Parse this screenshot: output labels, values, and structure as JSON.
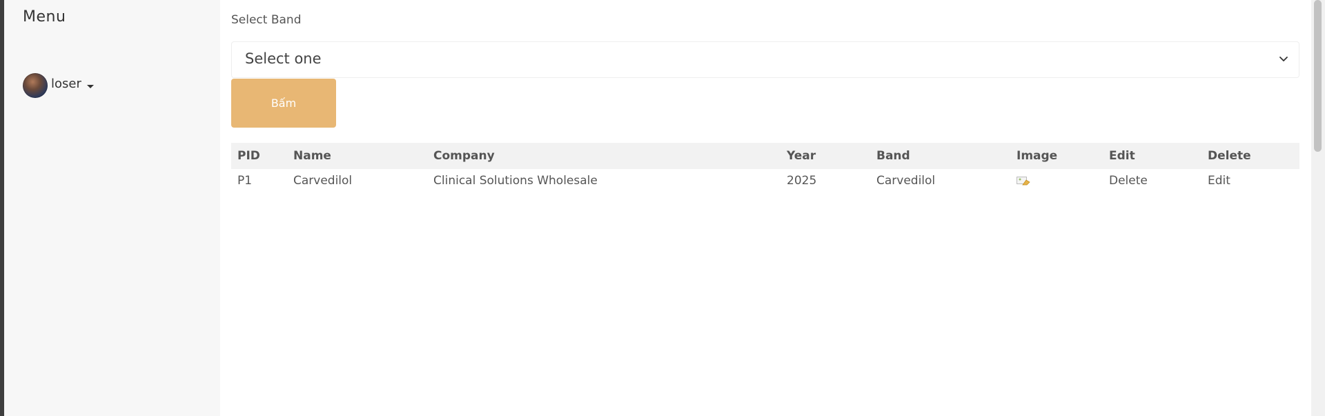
{
  "sidebar": {
    "title": "Menu",
    "user": {
      "name": "loser"
    }
  },
  "form": {
    "select_label": "Select Band",
    "select_value": "Select one",
    "submit_label": "Bấm"
  },
  "table": {
    "headers": [
      "PID",
      "Name",
      "Company",
      "Year",
      "Band",
      "Image",
      "Edit",
      "Delete"
    ],
    "rows": [
      {
        "pid": "P1",
        "name": "Carvedilol",
        "company": "Clinical Solutions Wholesale",
        "year": "2025",
        "band": "Carvedilol",
        "image_icon": "broken-image-icon",
        "edit_cell": "Delete",
        "delete_cell": "Edit"
      }
    ]
  },
  "colors": {
    "button": "#e8b774",
    "header_bg": "#f2f2f2",
    "sidebar_bg": "#f7f7f7"
  }
}
